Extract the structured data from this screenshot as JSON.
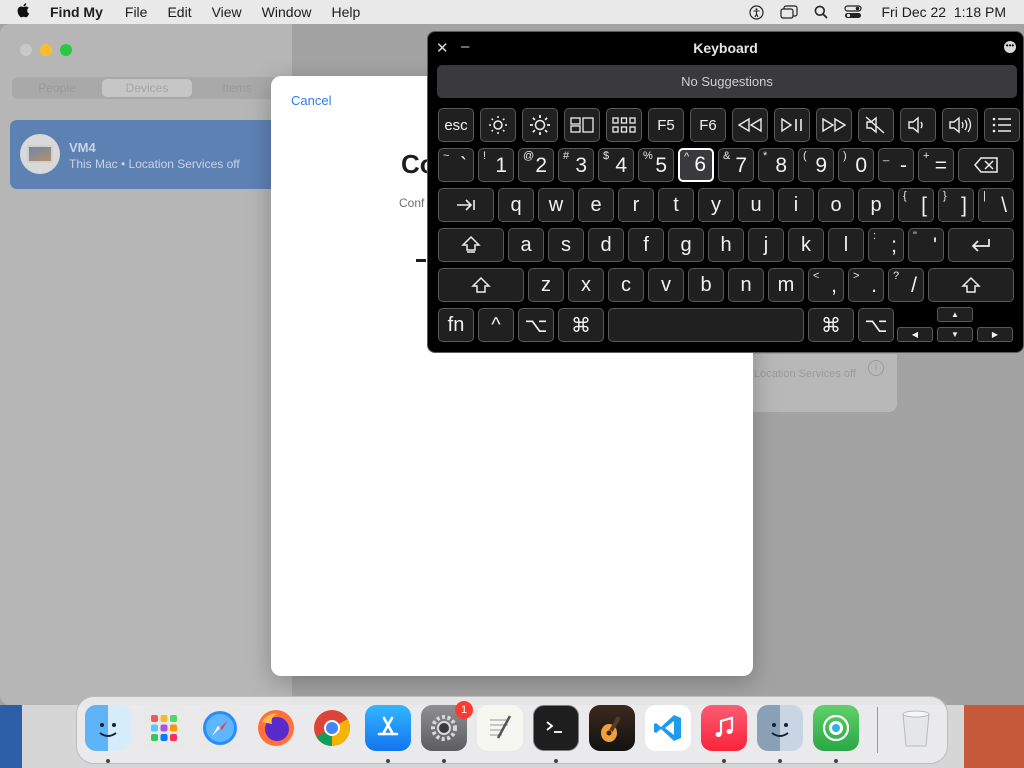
{
  "menubar": {
    "app_name": "Find My",
    "menus": [
      "File",
      "Edit",
      "View",
      "Window",
      "Help"
    ],
    "clock": "Fri Dec 22  1:18 PM"
  },
  "sidebar": {
    "tabs": [
      "People",
      "Devices",
      "Items"
    ],
    "selected_tab": "Devices",
    "device": {
      "name": "VM4",
      "subtitle": "This Mac • Location Services off"
    }
  },
  "detail_card": {
    "text": "Location Services off"
  },
  "sheet": {
    "cancel_label": "Cancel",
    "title_fragment": "Co",
    "subtitle_fragment": "Conf"
  },
  "keyboard_viewer": {
    "title": "Keyboard",
    "suggestions": "No Suggestions",
    "function_row": [
      "esc",
      "brightness-down-icon",
      "brightness-up-icon",
      "mission-control-icon",
      "launchpad-icon",
      "F5",
      "F6",
      "rewind-icon",
      "play-pause-icon",
      "fast-forward-icon",
      "mute-icon",
      "volume-down-icon",
      "volume-up-icon",
      "list-icon"
    ],
    "number_row": [
      {
        "shift": "~",
        "main": "`"
      },
      {
        "shift": "!",
        "main": "1"
      },
      {
        "shift": "@",
        "main": "2"
      },
      {
        "shift": "#",
        "main": "3"
      },
      {
        "shift": "$",
        "main": "4"
      },
      {
        "shift": "%",
        "main": "5"
      },
      {
        "shift": "^",
        "main": "6"
      },
      {
        "shift": "&",
        "main": "7"
      },
      {
        "shift": "*",
        "main": "8"
      },
      {
        "shift": "(",
        "main": "9"
      },
      {
        "shift": ")",
        "main": "0"
      },
      {
        "shift": "_",
        "main": "-"
      },
      {
        "shift": "+",
        "main": "="
      }
    ],
    "q_row": [
      "q",
      "w",
      "e",
      "r",
      "t",
      "y",
      "u",
      "i",
      "o",
      "p"
    ],
    "q_row_punct": [
      {
        "shift": "{",
        "main": "["
      },
      {
        "shift": "}",
        "main": "]"
      },
      {
        "shift": "|",
        "main": "\\"
      }
    ],
    "a_row": [
      "a",
      "s",
      "d",
      "f",
      "g",
      "h",
      "j",
      "k",
      "l"
    ],
    "a_row_punct": [
      {
        "shift": ":",
        "main": ";"
      },
      {
        "shift": "\"",
        "main": "'"
      }
    ],
    "z_row": [
      "z",
      "x",
      "c",
      "v",
      "b",
      "n",
      "m"
    ],
    "z_row_punct": [
      {
        "shift": "<",
        "main": ","
      },
      {
        "shift": ">",
        "main": "."
      },
      {
        "shift": "?",
        "main": "/"
      }
    ],
    "bottom_row": {
      "fn": "fn",
      "control": "^",
      "option": "⌥",
      "command": "⌘"
    },
    "active_key": "6"
  },
  "dock": {
    "apps": [
      "Finder",
      "Launchpad",
      "Safari",
      "Firefox",
      "Chrome",
      "App Store",
      "System Settings",
      "TextEdit",
      "Terminal",
      "GarageBand",
      "VS Code",
      "Music",
      "Migration Assistant",
      "Find My",
      "Trash"
    ],
    "settings_badge": "1"
  },
  "colors": {
    "accent": "#2e7cf6",
    "selected_row": "#5e81b4",
    "badge": "#ff3b30"
  }
}
